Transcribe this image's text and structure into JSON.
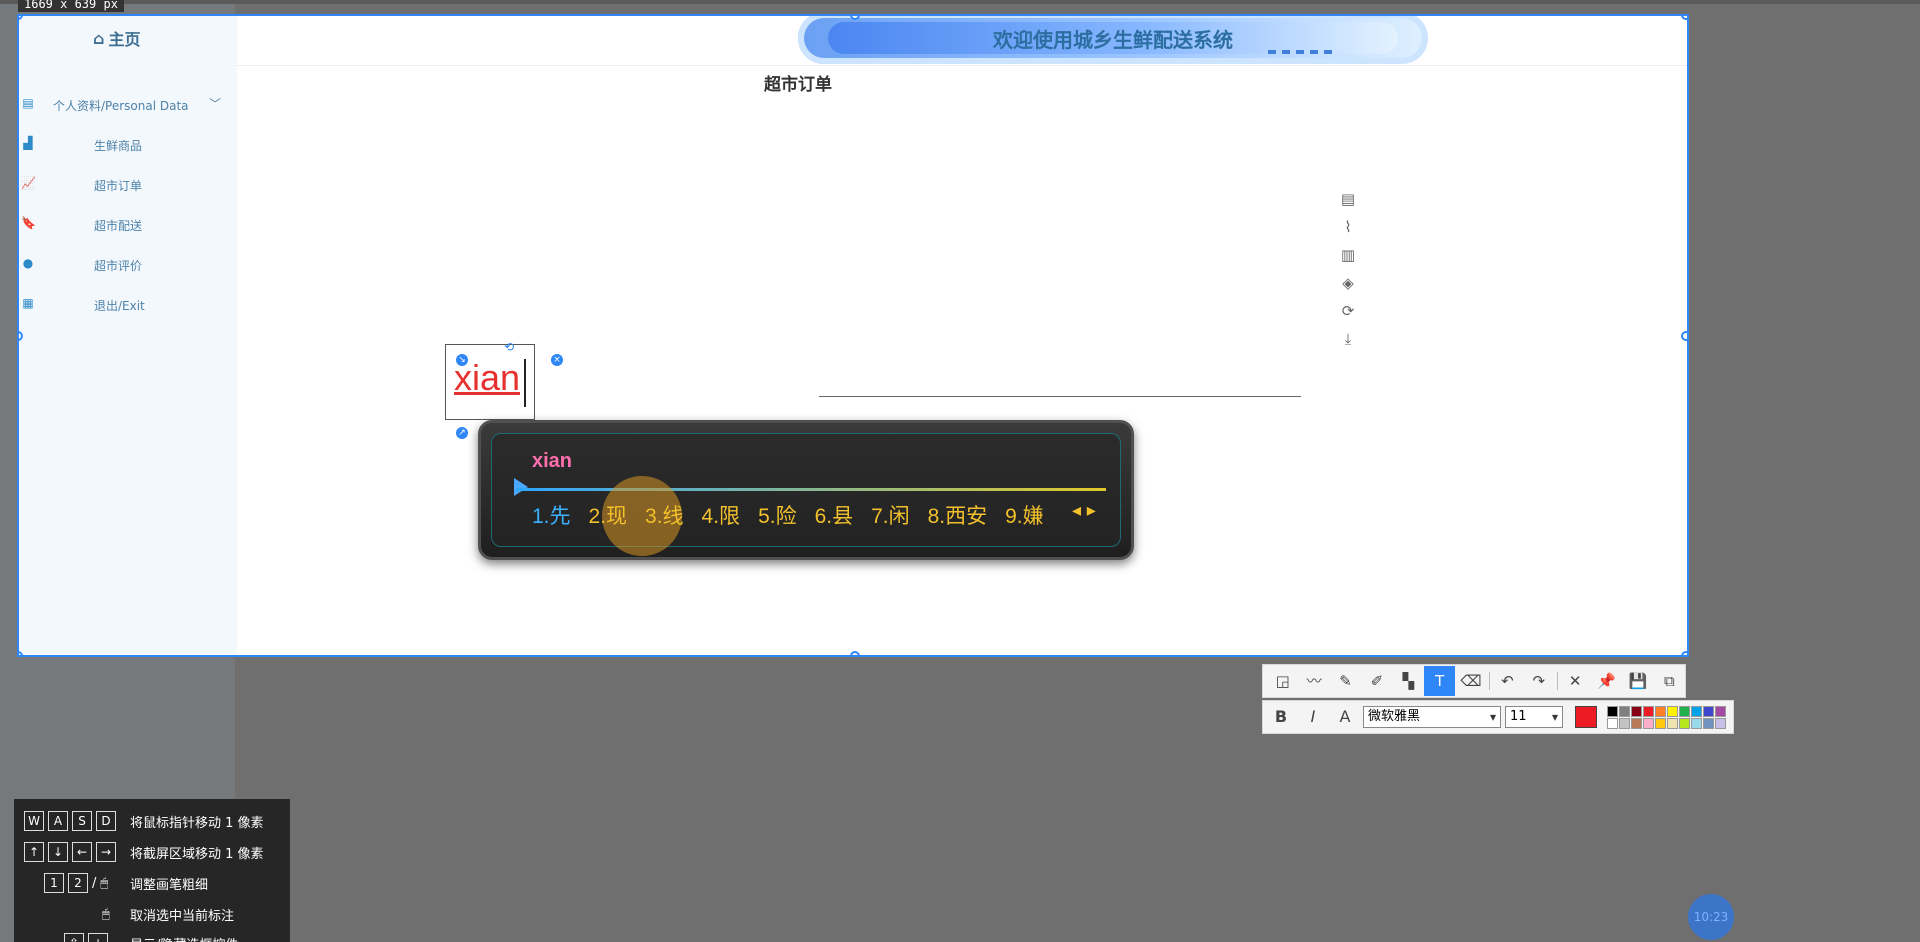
{
  "capture_size_label": "1669 x 639  px",
  "sidebar": {
    "home_label": "主页",
    "items": [
      {
        "label": "个人资料/Personal Data",
        "icon": "document-icon"
      },
      {
        "label": "生鲜商品",
        "icon": "grocery-icon"
      },
      {
        "label": "超市订单",
        "icon": "chart-icon"
      },
      {
        "label": "超市配送",
        "icon": "bookmark-icon"
      },
      {
        "label": "超市评价",
        "icon": "user-badge-icon"
      },
      {
        "label": "退出/Exit",
        "icon": "calendar-icon"
      }
    ]
  },
  "header": {
    "banner_text": "欢迎使用城乡生鲜配送系统"
  },
  "main": {
    "title": "超市订单"
  },
  "annotation": {
    "text": "xian",
    "color": "#e5322e"
  },
  "ime": {
    "composition": "xian",
    "candidates": [
      "1.先",
      "2.现",
      "3.线",
      "4.限",
      "5.险",
      "6.县",
      "7.闲",
      "8.西安",
      "9.嫌"
    ]
  },
  "toolbar2": {
    "font": "微软雅黑",
    "size": "11",
    "current_color": "#ed1c24",
    "palette": [
      "#000000",
      "#7f7f7f",
      "#880015",
      "#ed1c24",
      "#ff7f27",
      "#fff200",
      "#22b14c",
      "#00a2e8",
      "#3f48cc",
      "#a349a4",
      "#ffffff",
      "#c3c3c3",
      "#b97a57",
      "#ffaec9",
      "#ffc90e",
      "#efe4b0",
      "#b5e61d",
      "#99d9ea",
      "#7092be",
      "#c8bfe7"
    ]
  },
  "help": {
    "rows": [
      {
        "keys": [
          "W",
          "A",
          "S",
          "D"
        ],
        "text": "将鼠标指针移动 1 像素"
      },
      {
        "keys": [
          "↑",
          "↓",
          "←",
          "→"
        ],
        "text": "将截屏区域移动 1 像素"
      },
      {
        "keys": [
          "1",
          "2",
          "/",
          "🖱"
        ],
        "text": "调整画笔粗细"
      },
      {
        "keys": [
          "🖱"
        ],
        "text": "取消选中当前标注"
      },
      {
        "keys": [
          "⇧",
          "+"
        ],
        "text": "显示/隐藏选框控件"
      }
    ]
  },
  "clock": "10:23"
}
